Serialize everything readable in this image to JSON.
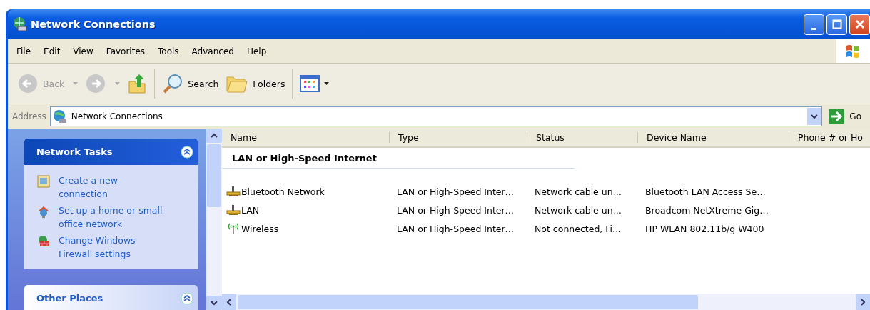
{
  "window": {
    "title": "Network Connections"
  },
  "menu": [
    "File",
    "Edit",
    "View",
    "Favorites",
    "Tools",
    "Advanced",
    "Help"
  ],
  "toolbar": [
    {
      "kind": "back",
      "label": "Back",
      "disabled": true
    },
    {
      "kind": "forward",
      "disabled": true
    },
    {
      "kind": "up"
    },
    {
      "kind": "search",
      "label": "Search"
    },
    {
      "kind": "folders",
      "label": "Folders"
    },
    {
      "kind": "views"
    }
  ],
  "address": {
    "label": "Address",
    "value": "Network Connections",
    "go": "Go"
  },
  "sidebar": [
    {
      "title": "Network Tasks",
      "expanded": true,
      "items": [
        {
          "kind": "new",
          "label": "Create a new connection"
        },
        {
          "kind": "home",
          "label": "Set up a home or small office network"
        },
        {
          "kind": "firewall",
          "label": "Change Windows Firewall settings"
        }
      ]
    },
    {
      "title": "Other Places",
      "expanded": true
    }
  ],
  "table": {
    "columns": [
      "Name",
      "Type",
      "Status",
      "Device Name",
      "Phone # or Ho"
    ],
    "group": "LAN or High-Speed Internet",
    "rows": [
      {
        "kind": "wired",
        "cells": [
          "Bluetooth Network",
          "LAN or High-Speed Inter…",
          "Network cable un…",
          "Bluetooth LAN Access Se…"
        ]
      },
      {
        "kind": "wired",
        "cells": [
          "LAN",
          "LAN or High-Speed Inter…",
          "Network cable un…",
          "Broadcom NetXtreme Gig…"
        ]
      },
      {
        "kind": "wireless",
        "cells": [
          "Wireless",
          "LAN or High-Speed Inter…",
          "Not connected, Fi…",
          "HP WLAN 802.11b/g W400"
        ]
      }
    ]
  }
}
